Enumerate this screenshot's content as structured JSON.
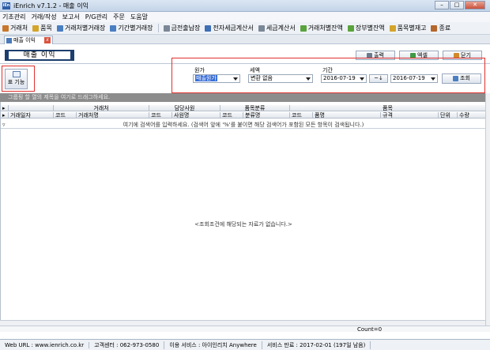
{
  "window": {
    "title": "iEnrich v7.1.2 - 매출 이익",
    "app_icon": "iEn"
  },
  "menu": [
    "기초관리",
    "거래/작성",
    "보고서",
    "P/G관리",
    "주문",
    "도움말"
  ],
  "toolbar": [
    {
      "label": "거래처",
      "icon": "person-icon",
      "color": "#c9772c"
    },
    {
      "label": "품목",
      "icon": "box-icon",
      "color": "#d4a52a"
    },
    {
      "label": "거래처별거래장",
      "icon": "ledger-icon",
      "color": "#4a7fc1"
    },
    {
      "label": "기간별거래장",
      "icon": "calendar-icon",
      "color": "#4a7fc1"
    },
    {
      "label": "금전출납장",
      "icon": "document-icon",
      "color": "#7a8796"
    },
    {
      "label": "전자세금계산서",
      "icon": "monitor-icon",
      "color": "#3f6fb5"
    },
    {
      "label": "세금계산서",
      "icon": "invoice-icon",
      "color": "#7a8796"
    },
    {
      "label": "거래처별잔액",
      "icon": "leaf-icon",
      "color": "#5aa33d"
    },
    {
      "label": "장부별잔액",
      "icon": "stack-icon",
      "color": "#5aa33d"
    },
    {
      "label": "품목별재고",
      "icon": "box-icon",
      "color": "#d4a52a"
    },
    {
      "label": "종료",
      "icon": "exit-icon",
      "color": "#b5662a"
    }
  ],
  "tab": {
    "label": "매출 이익",
    "close": "x"
  },
  "page_title": "매출 이익",
  "actions": {
    "print": "출력",
    "excel": "엑셀",
    "close": "닫기"
  },
  "function_button": "표 기능",
  "filters": {
    "source_label": "원가",
    "source_value": "매출원가",
    "tax_label": "세액",
    "tax_value": "변환 없음",
    "period_label": "기간",
    "date_from": "2016-07-19",
    "range_button": "~↓",
    "date_to": "2016-07-19",
    "search_button": "조회"
  },
  "group_hint": "그룹핑 할 열의 제목을 여기로 드래그하세요.",
  "grid": {
    "group_headers": [
      "거래처",
      "담당사원",
      "품목분류",
      "품목"
    ],
    "columns": [
      "거래일자",
      "코드",
      "거래처명",
      "코드",
      "사원명",
      "코드",
      "분류명",
      "코드",
      "품명",
      "규격",
      "단위",
      "수량"
    ],
    "filter_hint": "여기에 검색어를 입력하세요. (검색어 앞에 '%'를 붙이면 해당 검색어가 포함된 모든 항목이 검색됩니다.)",
    "empty_message": "<조회조건에 해당되는 자료가 없습니다.>",
    "count": "Count=0"
  },
  "status": {
    "web": "Web URL : www.ienrich.co.kr",
    "support": "고객센터 : 062-973-0580",
    "service": "이용 서비스 : 아이인리치 Anywhere",
    "expire": "서비스 만료 : 2017-02-01 (197일 남음)"
  }
}
